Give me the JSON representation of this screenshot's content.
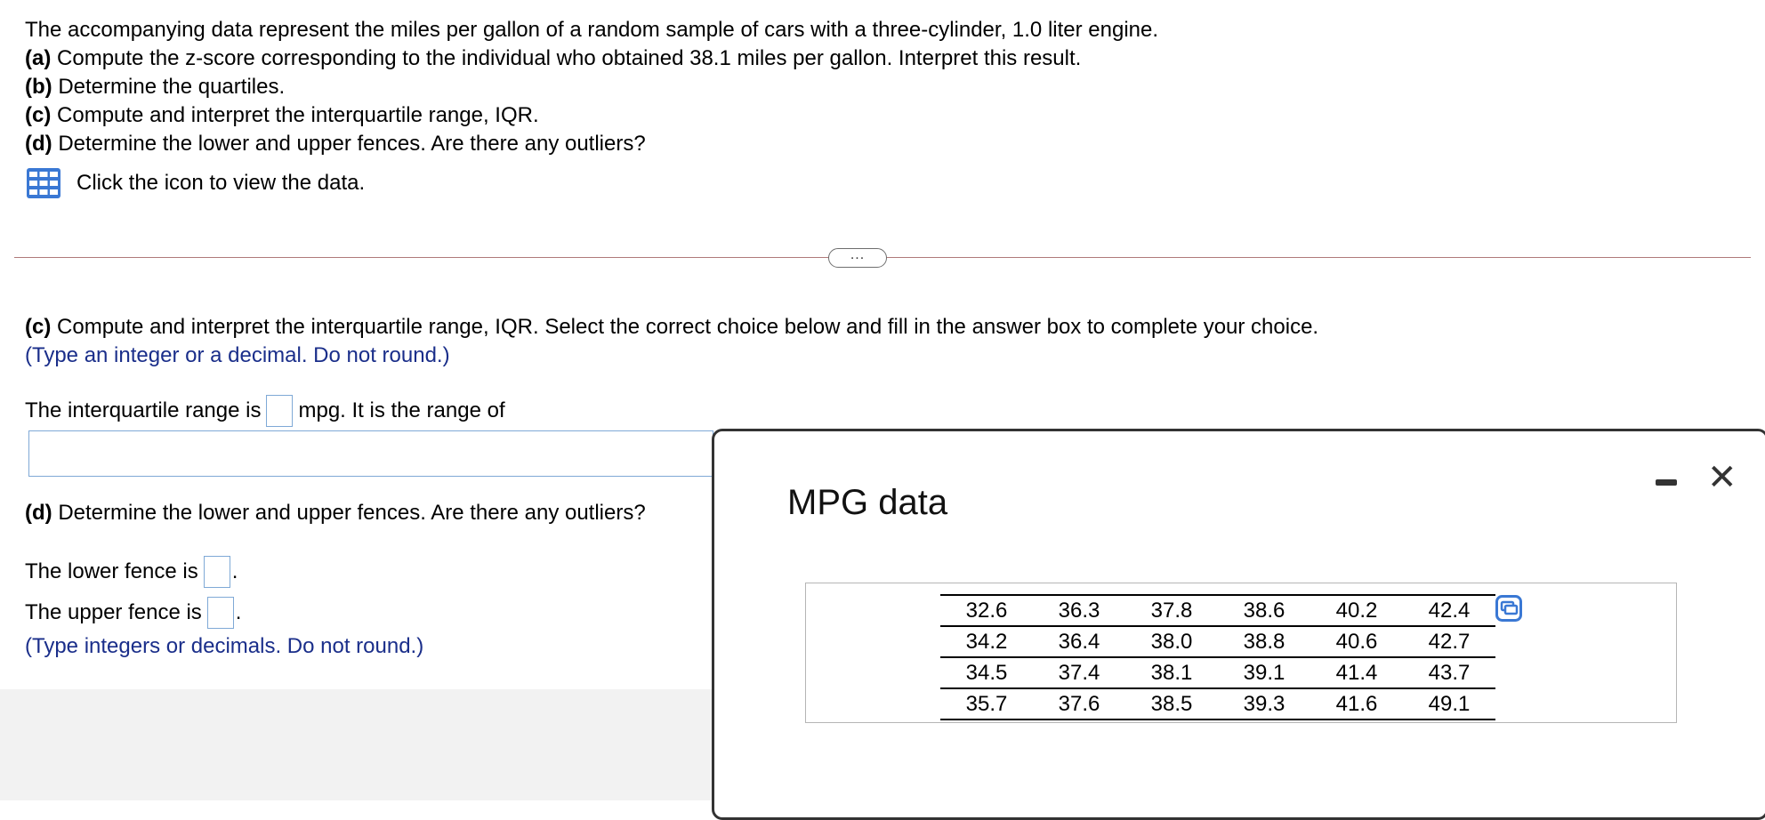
{
  "question": {
    "intro": "The accompanying data represent the miles per gallon of a random sample of cars with a three-cylinder, 1.0 liter engine.",
    "parts": [
      {
        "label": "(a)",
        "text": "Compute the z-score corresponding to the individual who obtained 38.1 miles per gallon. Interpret this result."
      },
      {
        "label": "(b)",
        "text": "Determine the quartiles."
      },
      {
        "label": "(c)",
        "text": "Compute and interpret the interquartile range, IQR."
      },
      {
        "label": "(d)",
        "text": "Determine the lower and upper fences. Are there any outliers?"
      }
    ],
    "data_link": "Click the icon to view the data."
  },
  "expand_button": "...",
  "part_c": {
    "label": "(c)",
    "text": "Compute and interpret the interquartile range, IQR. Select the correct choice below and fill in the answer box to complete your choice.",
    "hint": "(Type an integer or a decimal. Do not round.)",
    "iqr_prefix": "The interquartile range is",
    "iqr_suffix": "mpg. It is the range of",
    "iqr_value": "",
    "range_value": ""
  },
  "part_d": {
    "label": "(d)",
    "text": "Determine the lower and upper fences. Are there any outliers?",
    "lower_prefix": "The lower fence is",
    "upper_prefix": "The upper fence is",
    "period": ".",
    "lower_value": "",
    "upper_value": "",
    "hint": "(Type integers or decimals. Do not round.)"
  },
  "popup": {
    "title": "MPG data",
    "minimize_icon": "minimize-icon",
    "close_symbol": "✕",
    "table": [
      [
        "32.6",
        "36.3",
        "37.8",
        "38.6",
        "40.2",
        "42.4"
      ],
      [
        "34.2",
        "36.4",
        "38.0",
        "38.8",
        "40.6",
        "42.7"
      ],
      [
        "34.5",
        "37.4",
        "38.1",
        "39.1",
        "41.4",
        "43.7"
      ],
      [
        "35.7",
        "37.6",
        "38.5",
        "39.3",
        "41.6",
        "49.1"
      ]
    ]
  },
  "colors": {
    "hint_blue": "#1a2e8a",
    "input_border": "#7fa9d6",
    "icon_blue": "#3a78d4"
  }
}
